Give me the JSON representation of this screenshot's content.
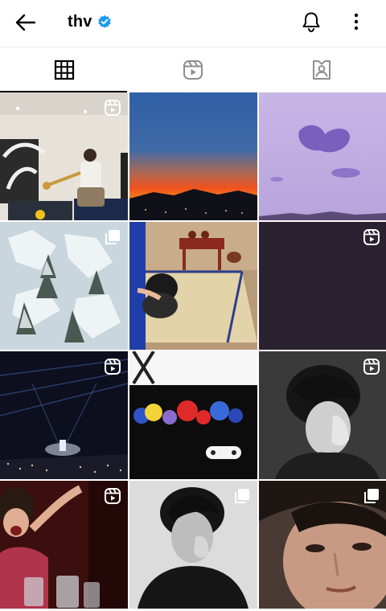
{
  "header": {
    "username": "thv",
    "icons": {
      "back": "arrow-left-icon",
      "verified": "verified-badge-icon",
      "notifications": "bell-icon",
      "more": "more-vertical-icon"
    },
    "verified_color": "#1d9bf0"
  },
  "tabs": [
    {
      "id": "posts",
      "icon": "grid-icon",
      "active": true
    },
    {
      "id": "reels",
      "icon": "reels-icon",
      "active": false
    },
    {
      "id": "tagged",
      "icon": "tagged-person-icon",
      "active": false
    }
  ],
  "grid": {
    "tiles": [
      {
        "subject": "room-trumpet",
        "badge": "reel"
      },
      {
        "subject": "sunset-skyline",
        "badge": "none"
      },
      {
        "subject": "purple-clouds",
        "badge": "none"
      },
      {
        "subject": "snowy-forest",
        "badge": "multiple"
      },
      {
        "subject": "tea-table-dog",
        "badge": "none"
      },
      {
        "subject": "dark-plain",
        "badge": "reel"
      },
      {
        "subject": "concert-stage",
        "badge": "reel"
      },
      {
        "subject": "plush-toys-controller",
        "badge": "none"
      },
      {
        "subject": "bw-portrait-hand",
        "badge": "reel"
      },
      {
        "subject": "crowd-woman-drinks",
        "badge": "reel"
      },
      {
        "subject": "bw-portrait-black-tee",
        "badge": "multiple"
      },
      {
        "subject": "closeup-portrait",
        "badge": "multiple"
      }
    ]
  }
}
